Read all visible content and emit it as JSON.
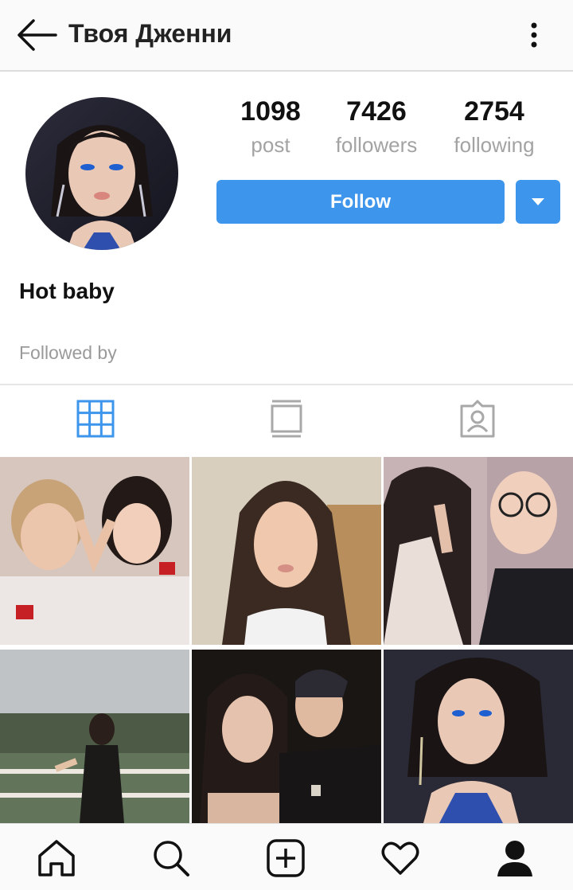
{
  "header": {
    "title": "Твоя Дженни",
    "back_icon": "arrow-left-icon",
    "menu_icon": "more-vertical-icon"
  },
  "profile": {
    "avatar_alt": "profile photo",
    "name": "Hot baby",
    "followed_by": "Followed by",
    "stats": [
      {
        "value": "1098",
        "label": "post"
      },
      {
        "value": "7426",
        "label": "followers"
      },
      {
        "value": "2754",
        "label": "following"
      }
    ],
    "follow_label": "Follow",
    "accent": "#3d95ec"
  },
  "tabs": [
    {
      "icon": "grid-icon",
      "active": true
    },
    {
      "icon": "feed-icon",
      "active": false
    },
    {
      "icon": "tagged-icon",
      "active": false
    }
  ],
  "bottom_nav": [
    "home-icon",
    "search-icon",
    "add-icon",
    "heart-icon",
    "profile-icon"
  ]
}
